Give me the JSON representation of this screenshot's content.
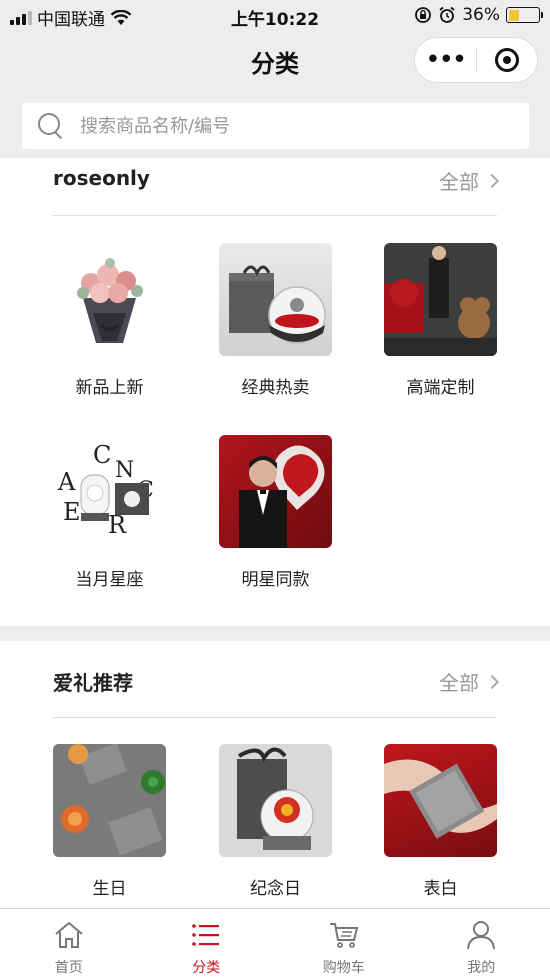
{
  "status_bar": {
    "carrier": "中国联通",
    "time": "上午10:22",
    "battery_percent": "36%",
    "battery_level": 0.36
  },
  "nav": {
    "title": "分类",
    "more_icon": "more-dots-icon",
    "close_icon": "target-circle-icon"
  },
  "search": {
    "placeholder": "搜索商品名称/编号"
  },
  "sections": [
    {
      "title": "roseonly",
      "all_label": "全部",
      "items": [
        {
          "label": "新品上新"
        },
        {
          "label": "经典热卖"
        },
        {
          "label": "高端定制"
        },
        {
          "label": "当月星座"
        },
        {
          "label": "明星同款"
        }
      ]
    },
    {
      "title": "爱礼推荐",
      "all_label": "全部",
      "items": [
        {
          "label": "生日"
        },
        {
          "label": "纪念日"
        },
        {
          "label": "表白"
        }
      ]
    }
  ],
  "tabs": [
    {
      "label": "首页",
      "icon": "home-icon",
      "active": false
    },
    {
      "label": "分类",
      "icon": "list-icon",
      "active": true
    },
    {
      "label": "购物车",
      "icon": "cart-icon",
      "active": false
    },
    {
      "label": "我的",
      "icon": "user-icon",
      "active": false
    }
  ],
  "colors": {
    "accent": "#c4161c",
    "background": "#ededed"
  }
}
